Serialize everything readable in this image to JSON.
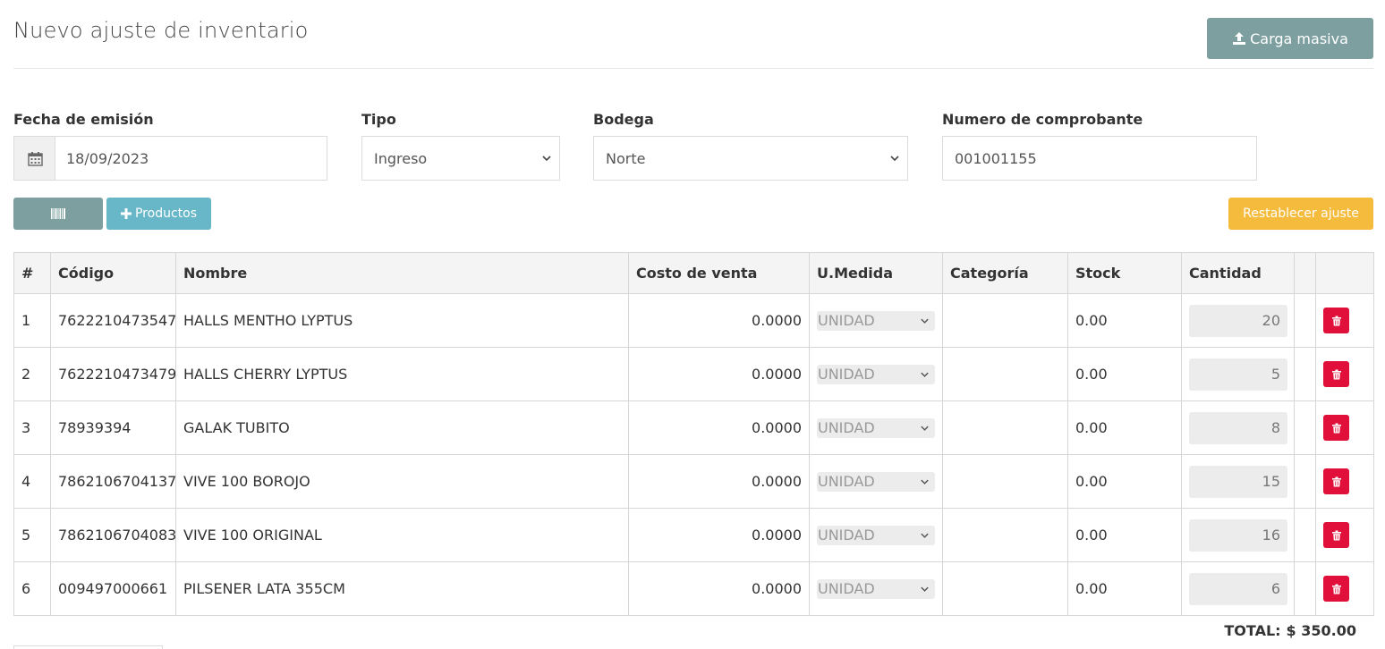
{
  "header": {
    "title": "Nuevo ajuste de inventario",
    "bulk_upload_label": "Carga masiva"
  },
  "form": {
    "fecha": {
      "label": "Fecha de emisión",
      "value": "18/09/2023"
    },
    "tipo": {
      "label": "Tipo",
      "value": "Ingreso"
    },
    "bodega": {
      "label": "Bodega",
      "value": "Norte"
    },
    "comprobante": {
      "label": "Numero de comprobante",
      "value": "001001155"
    }
  },
  "actions": {
    "products_label": "Productos",
    "reset_label": "Restablecer ajuste"
  },
  "table": {
    "columns": [
      "#",
      "Código",
      "Nombre",
      "Costo de venta",
      "U.Medida",
      "Categoría",
      "Stock",
      "Cantidad",
      "",
      ""
    ],
    "rows": [
      {
        "n": "1",
        "codigo": "7622210473547",
        "nombre": "HALLS MENTHO LYPTUS",
        "costo": "0.0000",
        "unidad": "UNIDAD",
        "categoria": "",
        "stock": "0.00",
        "cantidad": "20"
      },
      {
        "n": "2",
        "codigo": "7622210473479",
        "nombre": "HALLS CHERRY LYPTUS",
        "costo": "0.0000",
        "unidad": "UNIDAD",
        "categoria": "",
        "stock": "0.00",
        "cantidad": "5"
      },
      {
        "n": "3",
        "codigo": "78939394",
        "nombre": "GALAK TUBITO",
        "costo": "0.0000",
        "unidad": "UNIDAD",
        "categoria": "",
        "stock": "0.00",
        "cantidad": "8"
      },
      {
        "n": "4",
        "codigo": "7862106704137",
        "nombre": "VIVE 100 BOROJO",
        "costo": "0.0000",
        "unidad": "UNIDAD",
        "categoria": "",
        "stock": "0.00",
        "cantidad": "15"
      },
      {
        "n": "5",
        "codigo": "7862106704083",
        "nombre": "VIVE 100 ORIGINAL",
        "costo": "0.0000",
        "unidad": "UNIDAD",
        "categoria": "",
        "stock": "0.00",
        "cantidad": "16"
      },
      {
        "n": "6",
        "codigo": "009497000661",
        "nombre": "PILSENER LATA 355CM",
        "costo": "0.0000",
        "unidad": "UNIDAD",
        "categoria": "",
        "stock": "0.00",
        "cantidad": "6"
      }
    ]
  },
  "total": {
    "label": "TOTAL:",
    "value": "$ 350.00"
  },
  "colors": {
    "primary_gray": "#7d9fa0",
    "info": "#67b7c8",
    "warning": "#f5bb3d",
    "danger": "#e0103a"
  },
  "icons": {
    "bulk": "upload-icon",
    "date": "calendar-icon",
    "barcode": "barcode-icon",
    "add": "plus-icon",
    "delete": "trash-icon",
    "select": "chevron-down-icon"
  }
}
